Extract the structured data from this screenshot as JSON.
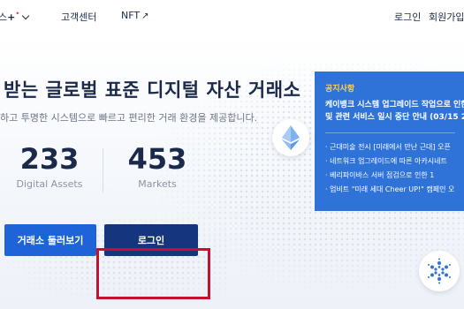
{
  "nav": {
    "items": [
      {
        "label": "스"
      },
      {
        "label": "고객센터"
      },
      {
        "label": "NFT"
      }
    ],
    "plus": "+",
    "dot": "•",
    "nft_arrow": "↗",
    "login": "로그인",
    "signup": "회원가입"
  },
  "hero": {
    "headline": "받는 글로벌 표준 디지털 자산 거래소",
    "subtext": "하고 투명한 시스템으로 빠르고 편리한 거래 환경을 제공합니다.",
    "stats": [
      {
        "value": "233",
        "label": "Digital Assets"
      },
      {
        "value": "453",
        "label": "Markets"
      }
    ],
    "buttons": {
      "explore": "거래소 둘러보기",
      "login": "로그인"
    }
  },
  "notice": {
    "title": "공지사항",
    "headline_line1": "케이뱅크 시스템 업그레이드 작업으로 인한",
    "headline_line2": "및 관련 서비스 일시 중단 안내 (03/15 23",
    "items": [
      "· 근대미술 전시 [미래에서 만난 근대] 오픈",
      "· 네트워크 업그레이드에 따른 아카시네트",
      "· 베리파이바스 서버 점검으로 인한 1",
      "· 업비트 \"미래 세대 Cheer UP!\" 캠페인 오"
    ]
  },
  "icons": {
    "eth": "ethereum-coin-icon",
    "ada": "cardano-coin-icon"
  },
  "colors": {
    "primary_button": "#1e64d8",
    "dark_button": "#15357f",
    "notice_bg": "#2f73d9",
    "notice_title": "#ffd33d",
    "highlight": "#c8102e"
  }
}
